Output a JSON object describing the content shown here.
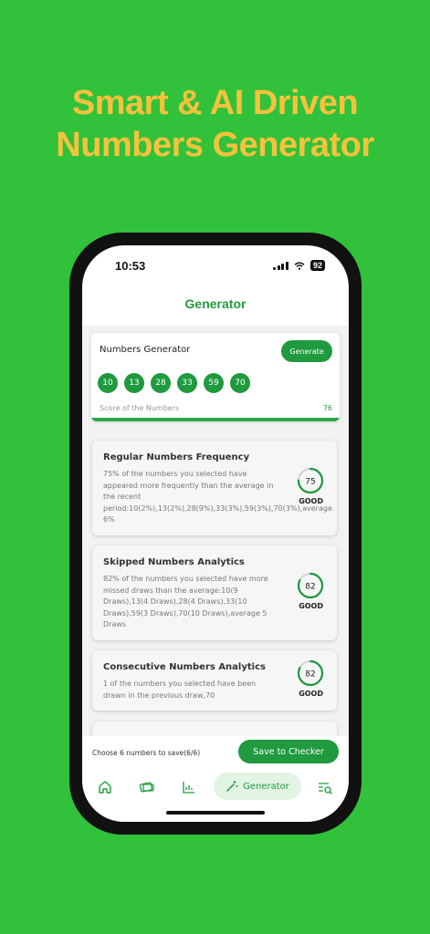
{
  "headline": {
    "line1": "Smart & AI Driven",
    "line2": "Numbers Generator"
  },
  "status": {
    "time": "10:53",
    "battery": "92"
  },
  "header": {
    "title": "Generator"
  },
  "generator": {
    "title": "Numbers Generator",
    "button_label": "Generate",
    "numbers": [
      "10",
      "13",
      "28",
      "33",
      "59",
      "70"
    ],
    "score_label": "Score of the Numbers",
    "score_value": "76"
  },
  "cards": [
    {
      "title": "Regular Numbers Frequency",
      "description": "75% of the numbers you selected have appeared more frequently than the average in the recent period:10(2%),13(2%),28(9%),33(3%),59(3%),70(3%),average 6%",
      "score": "75",
      "rating": "GOOD"
    },
    {
      "title": "Skipped Numbers Analytics",
      "description": "82% of the numbers you selected have more missed draws than the average:10(9 Draws),13(4 Draws),28(4 Draws),33(10 Draws),59(3 Draws),70(10 Draws),average 5 Draws",
      "score": "82",
      "rating": "GOOD"
    },
    {
      "title": "Consecutive Numbers Analytics",
      "description": "1 of the numbers you selected have been drawn in the previous draw,70",
      "score": "82",
      "rating": "GOOD"
    }
  ],
  "footer": {
    "save_info": "Choose 6 numbers to save(6/6)",
    "save_button": "Save to Checker"
  },
  "nav": {
    "active_label": "Generator"
  },
  "colors": {
    "brand_green": "#1f9a3e",
    "background": "#31c13b",
    "headline": "#f6c23c"
  }
}
